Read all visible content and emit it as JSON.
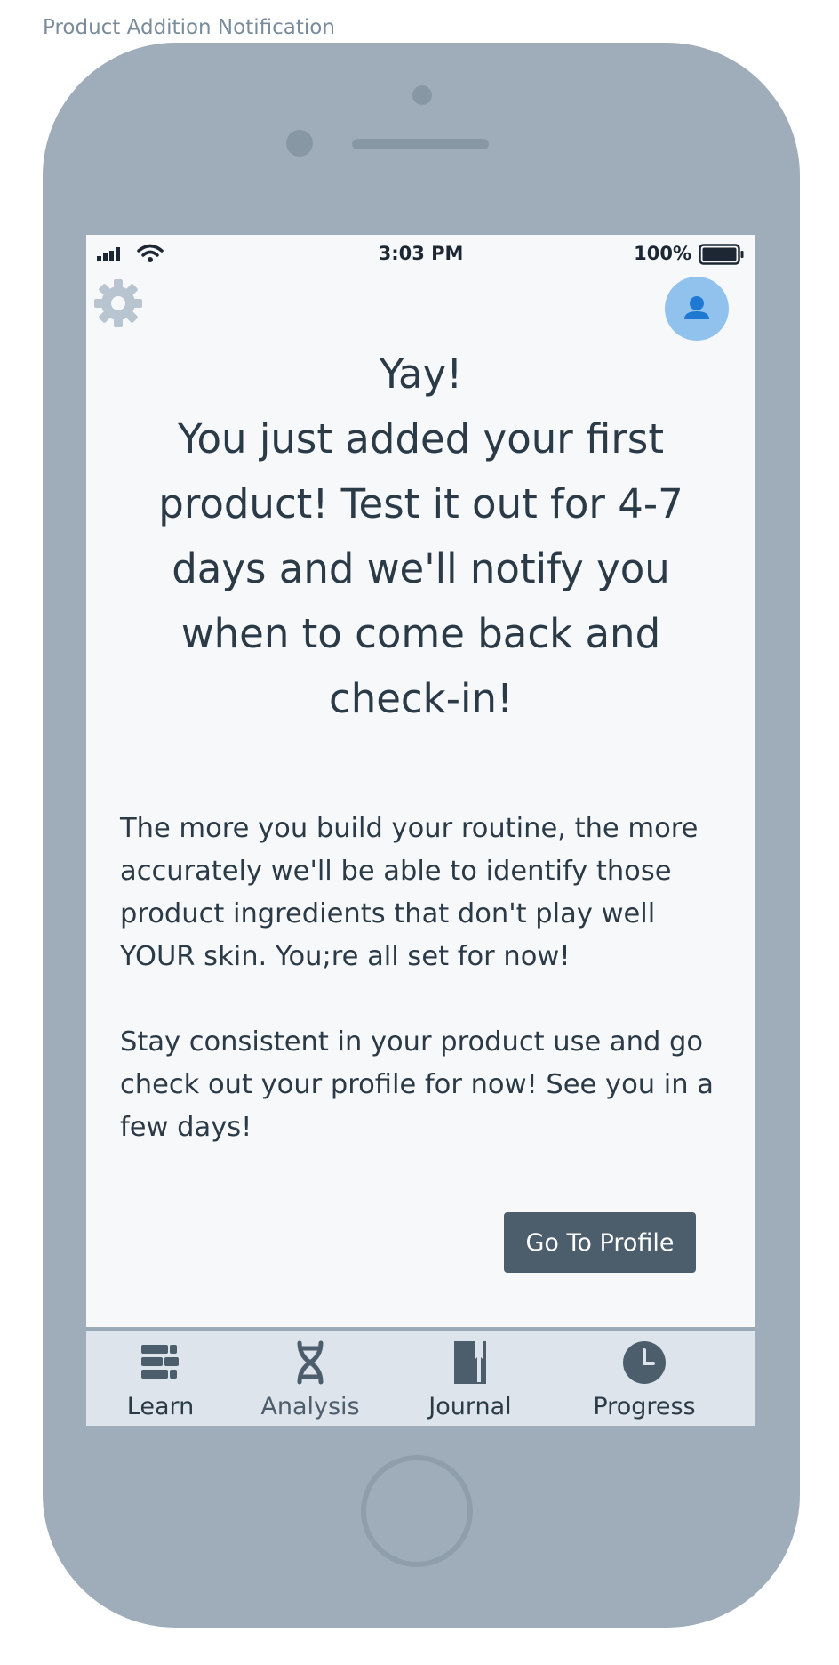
{
  "page_label": "Product Addition Notification",
  "status_bar": {
    "time": "3:03 PM",
    "battery_percent": "100%"
  },
  "icons": {
    "settings": "gear-icon",
    "avatar": "user-icon"
  },
  "colors": {
    "device": "#9eadb9",
    "screen": "#f6f8fa",
    "avatar_bg": "#91c2ee",
    "avatar_icon": "#1f78d1",
    "button_bg": "#4c5d6b",
    "tab_bar": "#dee4ec"
  },
  "headline": {
    "line1": "Yay!",
    "message": "You just added your first product! Test it out for 4-7 days and we'll notify you when to come back and check-in!"
  },
  "body": {
    "paragraph1": "The more you build your routine, the more accurately we'll be able to identify those product ingredients that don't play well YOUR skin. You;re all set for now!",
    "paragraph2": "Stay consistent in your product use and go check out your profile for now! See you in a few days!"
  },
  "button": {
    "label": "Go To Profile"
  },
  "tabs": [
    {
      "label": "Learn",
      "icon": "list-icon",
      "active": false
    },
    {
      "label": "Analysis",
      "icon": "dna-icon",
      "active": true
    },
    {
      "label": "Journal",
      "icon": "book-icon",
      "active": false
    },
    {
      "label": "Progress",
      "icon": "clock-icon",
      "active": false
    }
  ]
}
